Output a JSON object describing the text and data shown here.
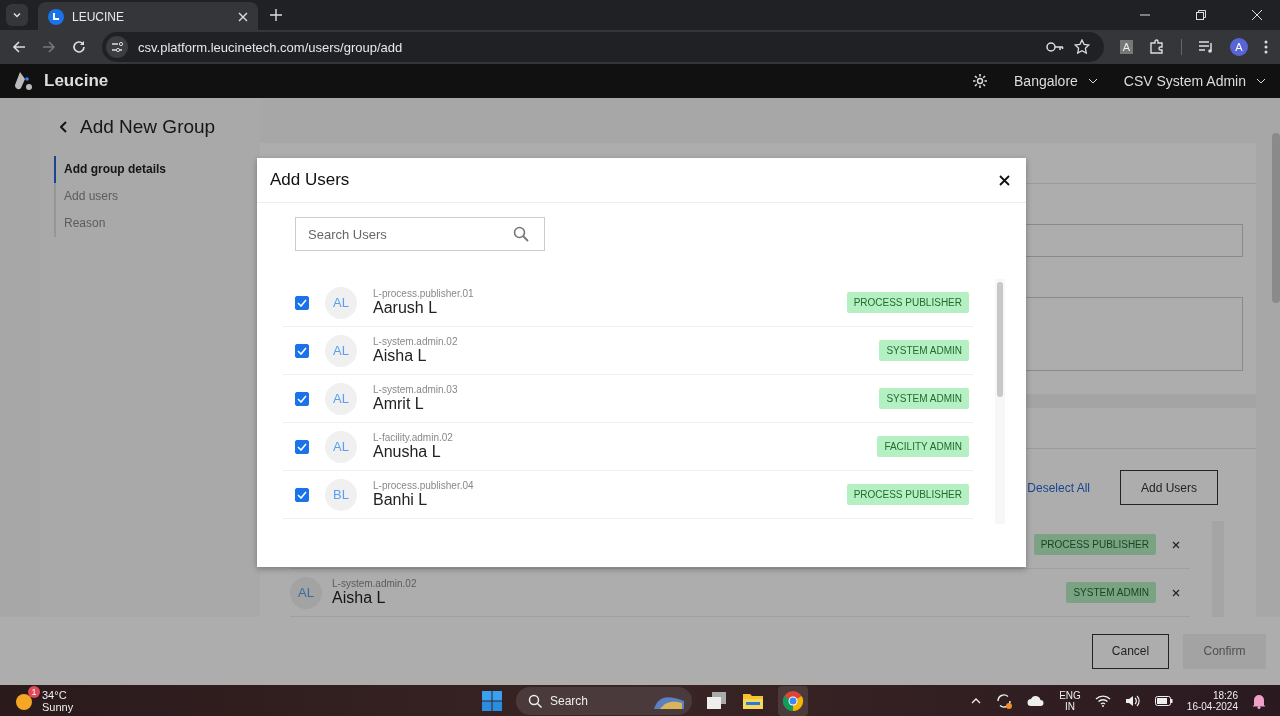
{
  "browser": {
    "tab_title": "LEUCINE",
    "url": "csv.platform.leucinetech.com/users/group/add",
    "extension_label": "A",
    "profile_initial": "A"
  },
  "app": {
    "brand": "Leucine",
    "location": "Bangalore",
    "user": "CSV System Admin"
  },
  "page": {
    "title": "Add New Group",
    "steps": [
      {
        "label": "Add group details",
        "selected": true
      },
      {
        "label": "Add users",
        "selected": false
      },
      {
        "label": "Reason",
        "selected": false
      }
    ],
    "deselect_all": "Deselect All",
    "add_users_button": "Add Users",
    "selected_users": [
      {
        "role": "PROCESS PUBLISHER"
      },
      {
        "initials": "AL",
        "username": "L-system.admin.02",
        "name": "Aisha L",
        "role": "SYSTEM ADMIN"
      }
    ],
    "buttons": [
      {
        "label": "Cancel",
        "disabled": false
      },
      {
        "label": "Confirm",
        "disabled": true
      }
    ]
  },
  "modal": {
    "title": "Add Users",
    "search": {
      "placeholder": "Search Users"
    },
    "users": [
      {
        "initials": "AL",
        "username": "L-process.publisher.01",
        "name": "Aarush L",
        "role": "PROCESS PUBLISHER",
        "checked": true
      },
      {
        "initials": "AL",
        "username": "L-system.admin.02",
        "name": "Aisha L",
        "role": "SYSTEM ADMIN",
        "checked": true
      },
      {
        "initials": "AL",
        "username": "L-system.admin.03",
        "name": "Amrit L",
        "role": "SYSTEM ADMIN",
        "checked": true
      },
      {
        "initials": "AL",
        "username": "L-facility.admin.02",
        "name": "Anusha L",
        "role": "FACILITY ADMIN",
        "checked": true
      },
      {
        "initials": "BL",
        "username": "L-process.publisher.04",
        "name": "Banhi L",
        "role": "PROCESS PUBLISHER",
        "checked": true
      }
    ]
  },
  "taskbar": {
    "weather_badge": "1",
    "temperature": "34°C",
    "condition": "Sunny",
    "search": "Search",
    "language": "ENG",
    "region": "IN",
    "time": "18:26",
    "date": "16-04-2024"
  }
}
